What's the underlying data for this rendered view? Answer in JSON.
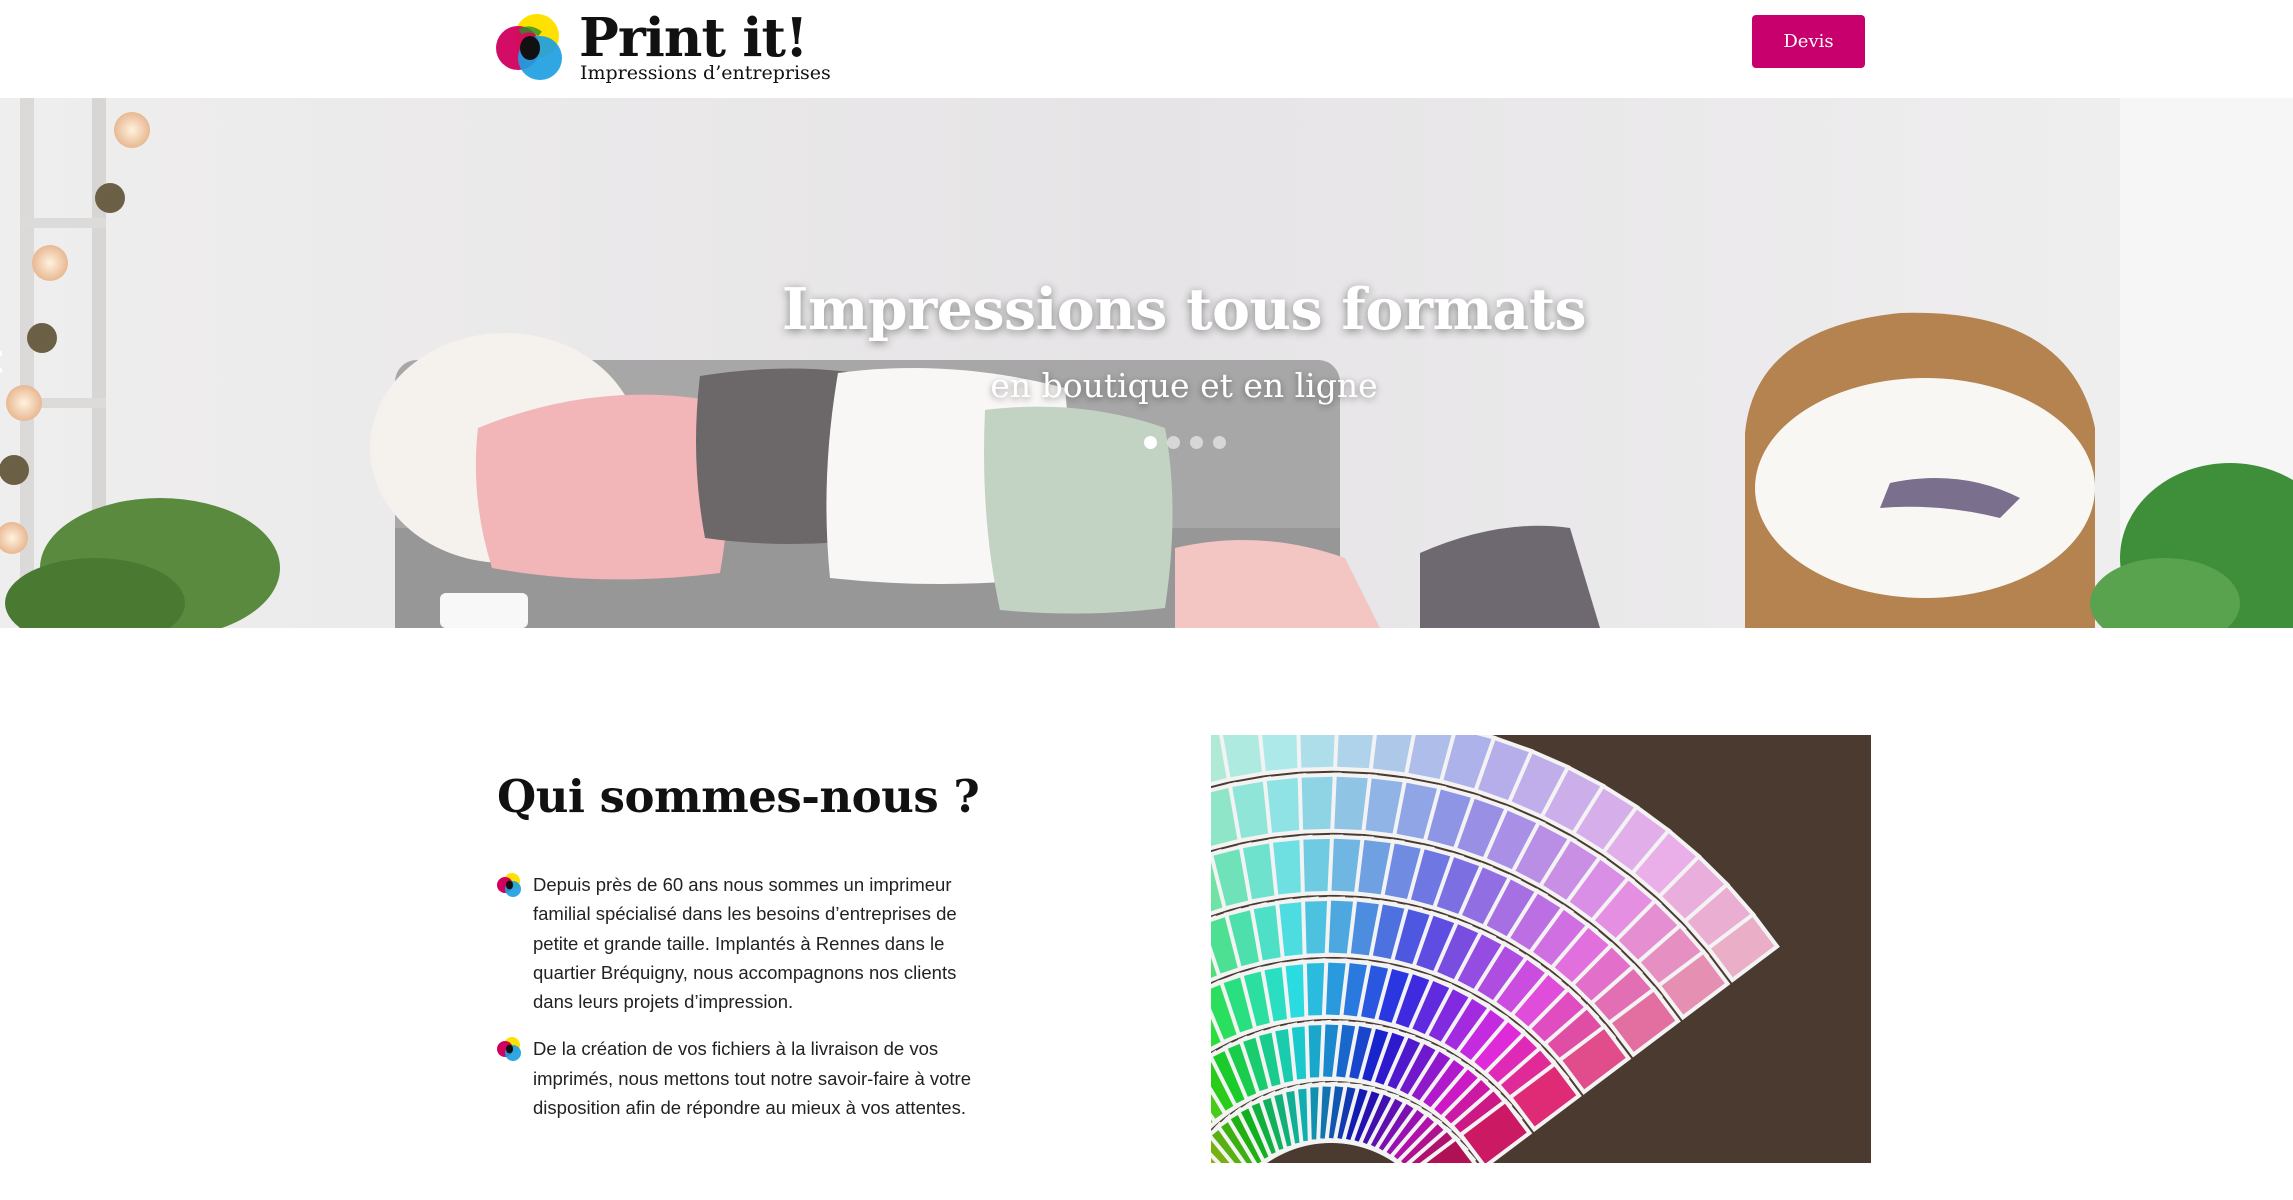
{
  "brand": {
    "name": "Print it!",
    "tagline": "Impressions d’entreprises",
    "logo_icon": "cmyk-circles-logo",
    "colors": {
      "cyan": "#1e9ee0",
      "magenta": "#d1005e",
      "yellow": "#ffe100",
      "black": "#111111"
    }
  },
  "header": {
    "devis_label": "Devis",
    "devis_color": "#c8006e"
  },
  "hero": {
    "title": "Impressions tous formats",
    "subtitle": "en boutique et en ligne",
    "slides_total": 4,
    "active_slide": 1,
    "prev_icon": "chevron-left-icon"
  },
  "about": {
    "title": "Qui sommes-nous ?",
    "bullet_icon": "cmyk-circles-icon",
    "paragraphs": [
      "Depuis près de 60 ans nous sommes un imprimeur familial spécialisé dans les besoins d’entreprises de petite et grande taille. Implantés à Rennes dans le quartier Bréquigny, nous accompagnons nos clients dans leurs projets d’impression.",
      "De la création de vos fichiers à la livraison de vos imprimés, nous mettons tout notre savoir-faire à votre disposition afin de répondre au mieux à vos attentes."
    ]
  }
}
